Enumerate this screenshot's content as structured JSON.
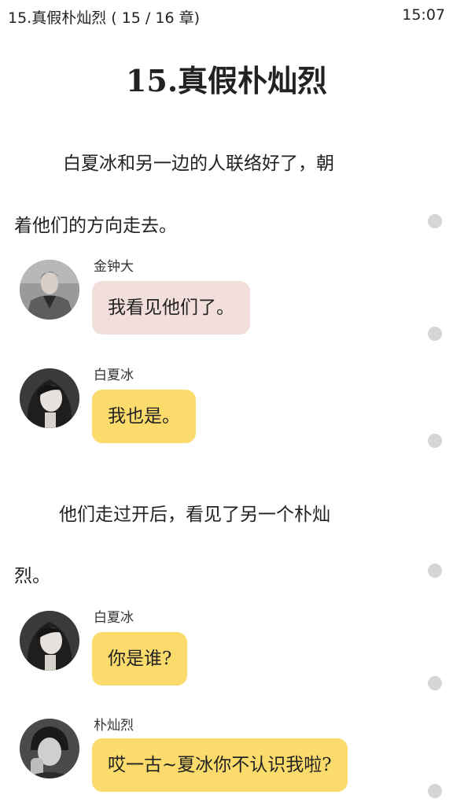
{
  "status_bar": {
    "title": "15.真假朴灿烈 ( 15 / 16 章)",
    "time": "15:07"
  },
  "chapter": {
    "title": "15.真假朴灿烈"
  },
  "content": {
    "para1_line1": "白夏冰和另一边的人联络好了，朝",
    "para1_line2": "着他们的方向走去。",
    "para2_line1": "他们走过开后，看见了另一个朴灿",
    "para2_line2": "烈。"
  },
  "messages": [
    {
      "sender": "金钟大",
      "text": "我看见他们了。",
      "bubble_color": "#f2dfdc",
      "avatar": "male-avatar-coat"
    },
    {
      "sender": "白夏冰",
      "text": "我也是。",
      "bubble_color": "#fbdb6c",
      "avatar": "female-avatar"
    },
    {
      "sender": "白夏冰",
      "text": "你是谁?",
      "bubble_color": "#fbdb6c",
      "avatar": "female-avatar"
    },
    {
      "sender": "朴灿烈",
      "text": "哎一古~夏冰你不认识我啦?",
      "bubble_color": "#fbdb6c",
      "avatar": "male-avatar-hand"
    }
  ],
  "colors": {
    "pink_bubble": "#f2dfdc",
    "yellow_bubble": "#fbdb6c",
    "side_dot": "#d6d6d6"
  }
}
